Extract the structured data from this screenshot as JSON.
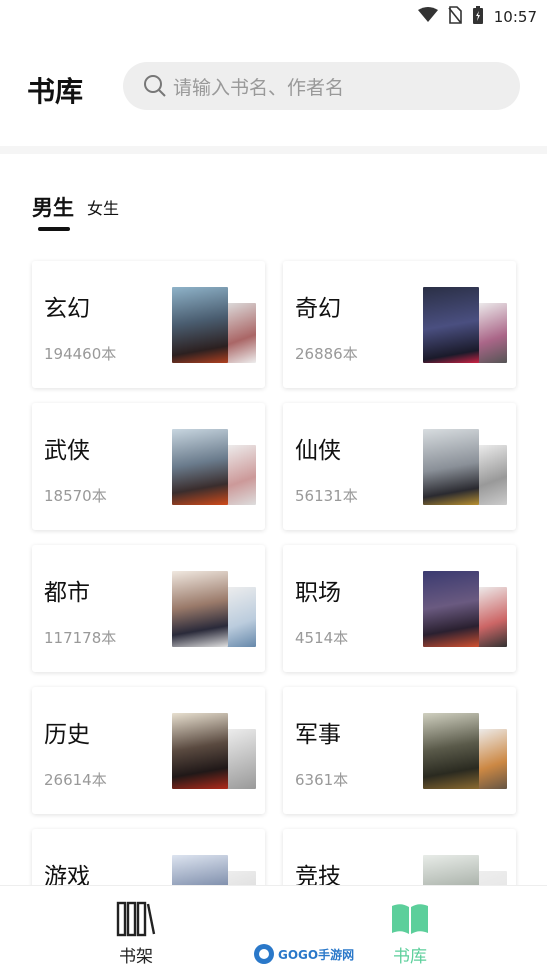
{
  "status": {
    "time": "10:57"
  },
  "header": {
    "title": "书库",
    "search_placeholder": "请输入书名、作者名"
  },
  "tabs": [
    {
      "label": "男生",
      "active": true
    },
    {
      "label": "女生",
      "active": false
    }
  ],
  "categories": [
    {
      "name": "玄幻",
      "count": "194460本"
    },
    {
      "name": "奇幻",
      "count": "26886本"
    },
    {
      "name": "武侠",
      "count": "18570本"
    },
    {
      "name": "仙侠",
      "count": "56131本"
    },
    {
      "name": "都市",
      "count": "117178本"
    },
    {
      "name": "职场",
      "count": "4514本"
    },
    {
      "name": "历史",
      "count": "26614本"
    },
    {
      "name": "军事",
      "count": "6361本"
    },
    {
      "name": "游戏",
      "count": ""
    },
    {
      "name": "竞技",
      "count": ""
    }
  ],
  "bottom_nav": [
    {
      "label": "书架",
      "icon": "bookshelf-icon",
      "active": false
    },
    {
      "label": "书库",
      "icon": "open-book-icon",
      "active": true
    }
  ],
  "watermark": "GOGO手游网",
  "colors": {
    "accent": "#5ccf9b",
    "text": "#111111",
    "muted": "#999999"
  }
}
